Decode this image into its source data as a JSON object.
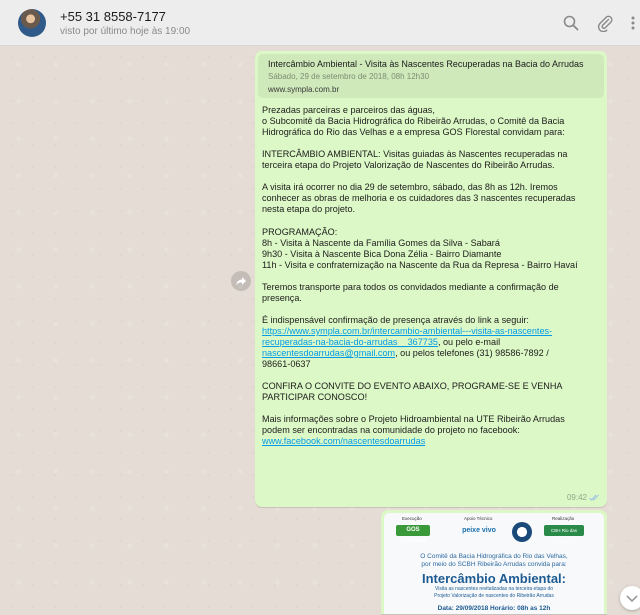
{
  "header": {
    "contact_name": "+55 31 8558-7177",
    "last_seen": "visto por último hoje às 19:00"
  },
  "message": {
    "preview": {
      "title": "Intercâmbio Ambiental - Visita às Nascentes Recuperadas na Bacia do Arrudas",
      "subtitle": "Sábado, 29 de setembro de 2018, 08h 12h30",
      "url": "www.sympla.com.br"
    },
    "paragraphs": [
      [
        "Prezadas parceiras e parceiros das águas,",
        "o Subcomitê da Bacia Hidrográfica do Ribeirão Arrudas, o Comitê da Bacia",
        "Hidrográfica do Rio das Velhas e a empresa GOS Florestal convidam para:"
      ],
      [
        "INTERCÂMBIO AMBIENTAL: Visitas guiadas às Nascentes recuperadas na",
        "terceira etapa do Projeto Valorização de Nascentes do Ribeirão Arrudas."
      ],
      [
        "A visita irá ocorrer no dia 29 de setembro, sábado, das 8h as 12h. Iremos",
        "conhecer as obras de melhoria e os cuidadores das 3 nascentes recuperadas",
        "nesta etapa do projeto."
      ],
      [
        "PROGRAMAÇÃO:",
        "8h - Visita à Nascente da Família Gomes da Silva - Sabará",
        "9h30 - Visita à Nascente Bica Dona Zélia - Bairro Diamante",
        "11h - Visita e confraternização na Nascente da Rua da Represa - Bairro Havaí"
      ],
      [
        "Teremos transporte para todos os convidados mediante a confirmação de",
        "presença."
      ]
    ],
    "link_para": {
      "intro": " É indispensável confirmação de presença através do link a seguir:",
      "link1_a": "https://www.sympla.com.br/intercambio-ambiental---visita-as-nascentes-",
      "link1_b": "recuperadas-na-bacia-do-arrudas__367735",
      "mid": ", ou pelo e-mail",
      "email": "nascentesdoarrudas@gmail.com",
      "phones": ", ou pelos telefones (31) 98586-7892 /",
      "phones2": "98661-0637"
    },
    "cta": [
      "CONFIRA O CONVITE DO EVENTO ABAIXO, PROGRAME-SE E VENHA",
      "PARTICIPAR CONOSCO!"
    ],
    "more": [
      "Mais informações sobre o  Projeto Hidroambiental na UTE Ribeirão Arrudas",
      "podem ser encontradas na comunidade do projeto no facebook:"
    ],
    "fb_link": "www.facebook.com/nascentesdoarrudas",
    "time": "09:42"
  },
  "image_message": {
    "label_execucao": "Execução",
    "label_apoio": "Apoio Técnico",
    "label_realizacao": "Realização",
    "logo_gos": "GOS Florestal",
    "logo_peixe": "peixe vivo",
    "logo_cbh": "CBH Rio das Velhas",
    "line1": "O Comitê da Bacia Hidrográfica do Rio das Velhas,",
    "line2": "por meio do SCBH Ribeirão Arrudas convida para:",
    "headline": "Intercâmbio Ambiental:",
    "line3": "Visita as nascentes revitalizadas na terceira etapa do",
    "line4": "Projeto Valorização de nascentes do Ribeirão Arrudas",
    "date_line": "Data: 29/09/2018   Horário: 08h as 12h"
  }
}
